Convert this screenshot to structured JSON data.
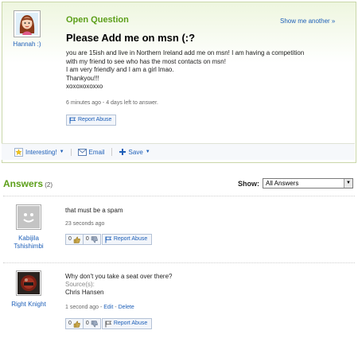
{
  "question": {
    "status": "Open Question",
    "show_another": "Show me another »",
    "asker_name": "Hannah :)",
    "title": "Please Add me on msn (:?",
    "body_lines": [
      "you are 15ish and live in Northern Ireland add me on msn! I am having a competition",
      "with my friend to see who has the most contacts on msn!",
      "I am very friendly and I am a girl lmao.",
      "Thankyou!!!",
      "xoxoxoxoxxo"
    ],
    "meta": "6 minutes ago - 4 days left to answer.",
    "report_label": "Report Abuse"
  },
  "actions": {
    "interesting": "Interesting!",
    "email": "Email",
    "save": "Save"
  },
  "answers_header": {
    "title": "Answers",
    "count": "(2)",
    "show_label": "Show:",
    "show_value": "All Answers"
  },
  "answers": [
    {
      "user": "Kabijila Tshishimbi",
      "text": "that must be a spam",
      "meta": "23 seconds ago",
      "up": "0",
      "down": "0",
      "report": "Report Abuse"
    },
    {
      "user": "Right Knight",
      "text": "Why don't you take a seat over there?",
      "sources_label": "Source(s):",
      "source": "Chris Hansen",
      "meta": "1 second ago - ",
      "edit": "Edit",
      "delete": "Delete",
      "up": "0",
      "down": "0",
      "report": "Report Abuse"
    }
  ],
  "colors": {
    "accent_green": "#5c9f19",
    "link_blue": "#1d5fb8"
  }
}
